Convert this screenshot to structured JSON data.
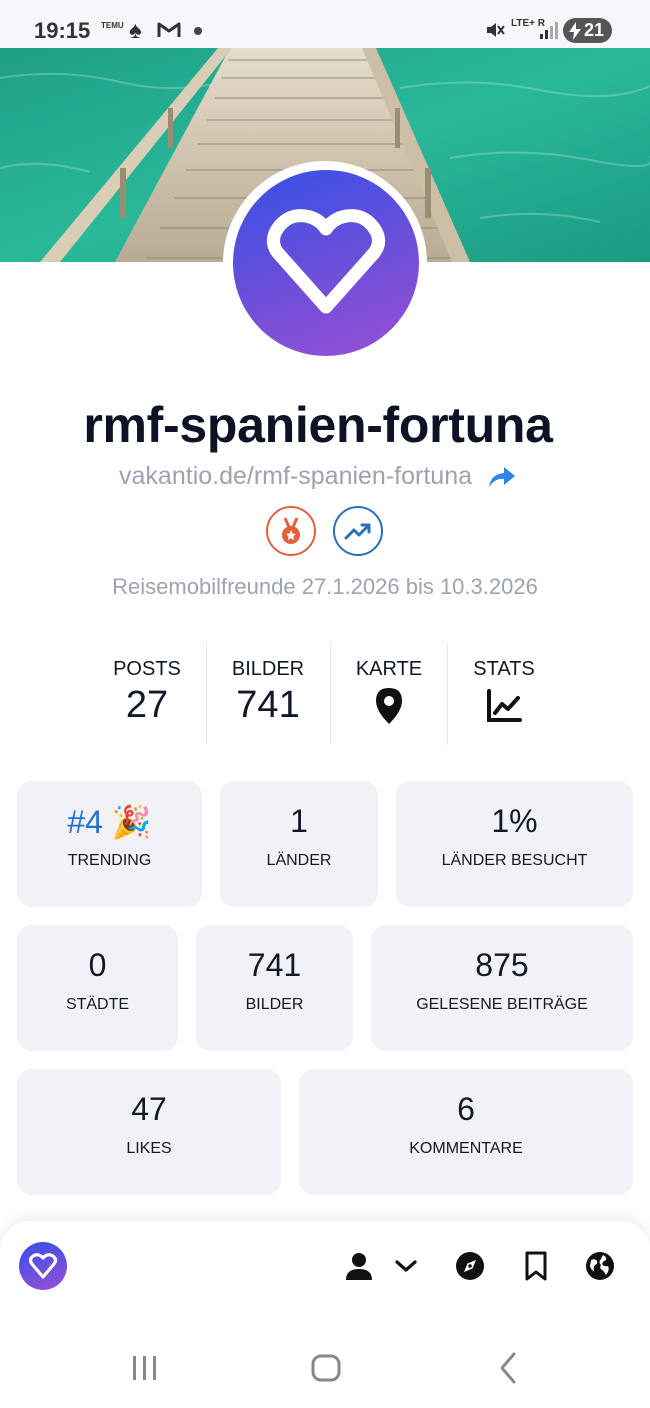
{
  "status_bar": {
    "time": "19:15",
    "mini_app_label": "TEMU",
    "network": "LTE+ R",
    "battery": "21"
  },
  "profile": {
    "username": "rmf-spanien-fortuna",
    "url": "vakantio.de/rmf-spanien-fortuna",
    "period": "Reisemobilfreunde 27.1.2026 bis 10.3.2026",
    "badges": [
      "medal-icon",
      "trending-icon"
    ]
  },
  "stats": [
    {
      "label": "POSTS",
      "value": "27"
    },
    {
      "label": "BILDER",
      "value": "741"
    },
    {
      "label": "KARTE",
      "icon": "map-pin-icon"
    },
    {
      "label": "STATS",
      "icon": "chart-line-icon"
    }
  ],
  "cards": {
    "trending": {
      "value": "#4 🎉",
      "label": "TRENDING"
    },
    "laender": {
      "value": "1",
      "label": "LÄNDER"
    },
    "laender_besucht": {
      "value": "1%",
      "label": "LÄNDER BESUCHT"
    },
    "staedte": {
      "value": "0",
      "label": "STÄDTE"
    },
    "bilder": {
      "value": "741",
      "label": "BILDER"
    },
    "gelesene": {
      "value": "875",
      "label": "GELESENE BEITRÄGE"
    },
    "likes": {
      "value": "47",
      "label": "LIKES"
    },
    "kommentare": {
      "value": "6",
      "label": "KOMMENTARE"
    }
  },
  "bottom_nav": [
    "logo-icon",
    "user-icon",
    "chevron-down-icon",
    "compass-icon",
    "bookmark-icon",
    "globe-icon"
  ],
  "colors": {
    "brand_gradient_start": "#3550e6",
    "brand_gradient_end": "#9a4fd6",
    "trending_blue": "#1e6fd8",
    "medal_orange": "#e3603a",
    "card_bg": "#f2f2f6"
  }
}
